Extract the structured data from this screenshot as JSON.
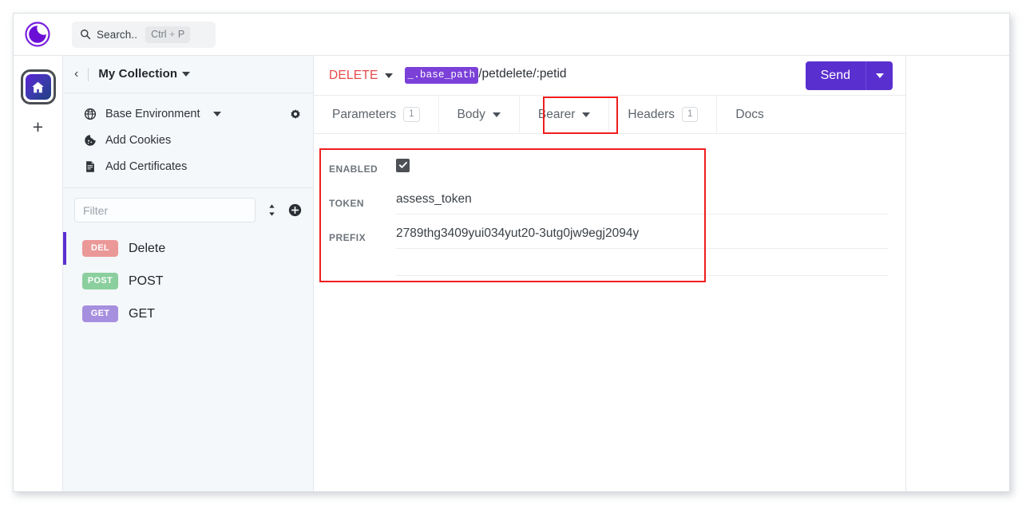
{
  "app": {
    "brand_icon": "insomnia-logo-icon",
    "accent_color": "#5a2fd0",
    "annotation_color": "#f01d1d"
  },
  "topbar": {
    "search_icon": "search-icon",
    "search_label": "Search..",
    "shortcut_prefix": "Ctrl",
    "shortcut_plus": "+",
    "shortcut_key": "P"
  },
  "rail": {
    "home_icon": "home-icon",
    "add_label": "+"
  },
  "sidebar": {
    "back_icon": "chevron-left-icon",
    "collection_name": "My Collection",
    "collection_caret": "chevron-down-icon",
    "environment": {
      "icon": "globe-icon",
      "label": "Base Environment",
      "caret": "chevron-down-icon",
      "gear_icon": "gear-icon"
    },
    "cookies": {
      "icon": "cookie-icon",
      "label": "Add Cookies"
    },
    "certificates": {
      "icon": "certificate-icon",
      "label": "Add Certificates"
    },
    "filter": {
      "placeholder": "Filter",
      "value": "",
      "sort_icon": "sort-icon",
      "add_icon": "plus-circle-icon"
    },
    "requests": [
      {
        "method": "DEL",
        "label": "Delete",
        "color": "#eb9898",
        "active": true
      },
      {
        "method": "POST",
        "label": "POST",
        "color": "#8bcf9e",
        "active": false
      },
      {
        "method": "GET",
        "label": "GET",
        "color": "#a78fdf",
        "active": false
      }
    ]
  },
  "request": {
    "method": "DELETE",
    "method_caret": "chevron-down-icon",
    "url_variable": "_.base_path",
    "url_path": "/petdelete/:petid",
    "send_label": "Send",
    "send_caret": "chevron-down-icon",
    "tabs": [
      {
        "label": "Parameters",
        "badge": "1",
        "caret": false,
        "active": false
      },
      {
        "label": "Body",
        "badge": null,
        "caret": true,
        "active": false
      },
      {
        "label": "Bearer",
        "badge": null,
        "caret": true,
        "active": true
      },
      {
        "label": "Headers",
        "badge": "1",
        "caret": false,
        "active": false
      },
      {
        "label": "Docs",
        "badge": null,
        "caret": false,
        "active": false
      }
    ],
    "auth": {
      "enabled_label": "ENABLED",
      "enabled_checked": true,
      "check_icon": "checkmark-icon",
      "token_label": "TOKEN",
      "token_value": "assess_token",
      "prefix_label": "PREFIX",
      "prefix_value": "2789thg3409yui034yut20-3utg0jw9egj2094y"
    }
  }
}
